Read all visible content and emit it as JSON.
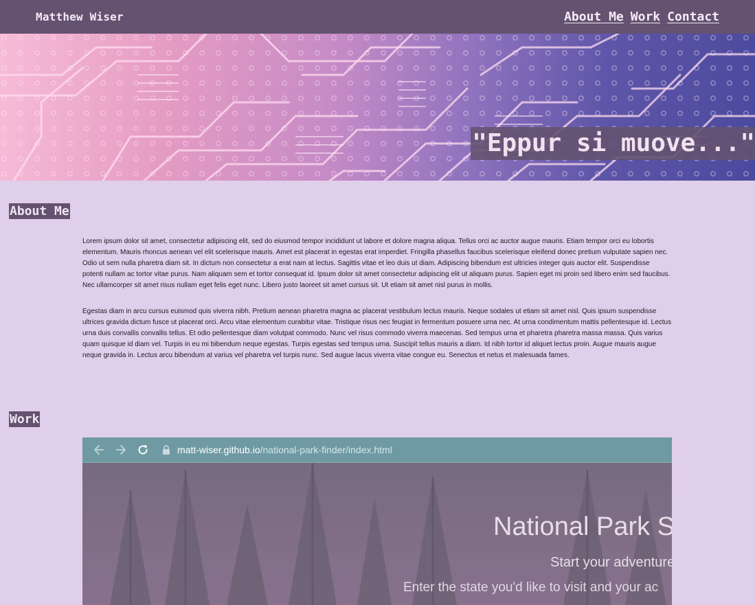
{
  "header": {
    "brand": "Matthew Wiser",
    "nav": [
      "About Me",
      "Work",
      "Contact"
    ]
  },
  "hero": {
    "quote": "\"Eppur si muove...\""
  },
  "about": {
    "heading": "About Me",
    "paragraphs": [
      "Lorem ipsum dolor sit amet, consectetur adipiscing elit, sed do eiusmod tempor incididunt ut labore et dolore magna aliqua. Tellus orci ac auctor augue mauris. Etiam tempor orci eu lobortis elementum. Mauris rhoncus aenean vel elit scelerisque mauris. Amet est placerat in egestas erat imperdiet. Fringilla phasellus faucibus scelerisque eleifend donec pretium vulputate sapien nec. Odio ut sem nulla pharetra diam sit. In dictum non consectetur a erat nam at lectus. Sagittis vitae et leo duis ut diam. Adipiscing bibendum est ultricies integer quis auctor elit. Suspendisse potenti nullam ac tortor vitae purus. Nam aliquam sem et tortor consequat id. Ipsum dolor sit amet consectetur adipiscing elit ut aliquam purus. Sapien eget mi proin sed libero enim sed faucibus. Nec ullamcorper sit amet risus nullam eget felis eget nunc. Libero justo laoreet sit amet cursus sit. Ut etiam sit amet nisl purus in mollis.",
      "Egestas diam in arcu cursus euismod quis viverra nibh. Pretium aenean pharetra magna ac placerat vestibulum lectus mauris. Neque sodales ut etiam sit amet nisl. Quis ipsum suspendisse ultrices gravida dictum fusce ut placerat orci. Arcu vitae elementum curabitur vitae. Tristique risus nec feugiat in fermentum posuere urna nec. At urna condimentum mattis pellentesque id. Lectus urna duis convallis convallis tellus. Et odio pellentesque diam volutpat commodo. Nunc vel risus commodo viverra maecenas. Sed tempus urna et pharetra pharetra massa massa. Quis varius quam quisque id diam vel. Turpis in eu mi bibendum neque egestas. Turpis egestas sed tempus urna. Suscipit tellus mauris a diam. Id nibh tortor id aliquet lectus proin. Augue mauris augue neque gravida in. Lectus arcu bibendum at varius vel pharetra vel turpis nunc. Sed augue lacus viverra vitae congue eu. Senectus et netus et malesuada fames."
    ]
  },
  "work": {
    "heading": "Work",
    "project": {
      "url_domain": "matt-wiser.github.io",
      "url_path": "/national-park-finder/index.html",
      "title": "National Park S",
      "subtitle": "Start your adventure",
      "description": "Enter the state you'd like to visit and your ac"
    }
  },
  "colors": {
    "header_bg": "#645270",
    "page_bg": "#e0cfea",
    "browser_bar": "#6f9aa3"
  },
  "icons": {
    "back": "arrow-left-icon",
    "forward": "arrow-right-icon",
    "reload": "reload-icon",
    "lock": "lock-icon"
  }
}
